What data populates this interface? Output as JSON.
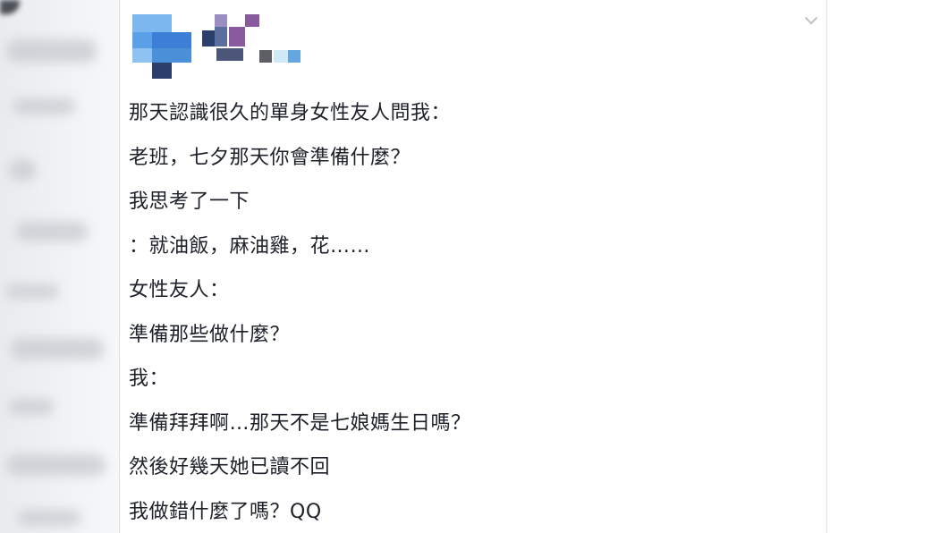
{
  "post": {
    "lines": [
      "那天認識很久的單身女性友人問我：",
      "老班，七夕那天你會準備什麼？",
      "我思考了一下",
      "：就油飯，麻油雞，花……",
      "女性友人：",
      "準備那些做什麼？",
      "我：",
      "準備拜拜啊…那天不是七娘媽生日嗎？",
      "然後好幾天她已讀不回",
      "我做錯什麼了嗎？QQ"
    ],
    "menu_icon": "chevron-down-icon"
  },
  "colors": {
    "text": "#1d2129",
    "card_border": "#dddfe2",
    "feed_background": "#e9ebee",
    "avatar_blue": "#4a90d9",
    "mosaic_purple": "#8a5a9e",
    "mosaic_navy": "#2c3e6b"
  }
}
